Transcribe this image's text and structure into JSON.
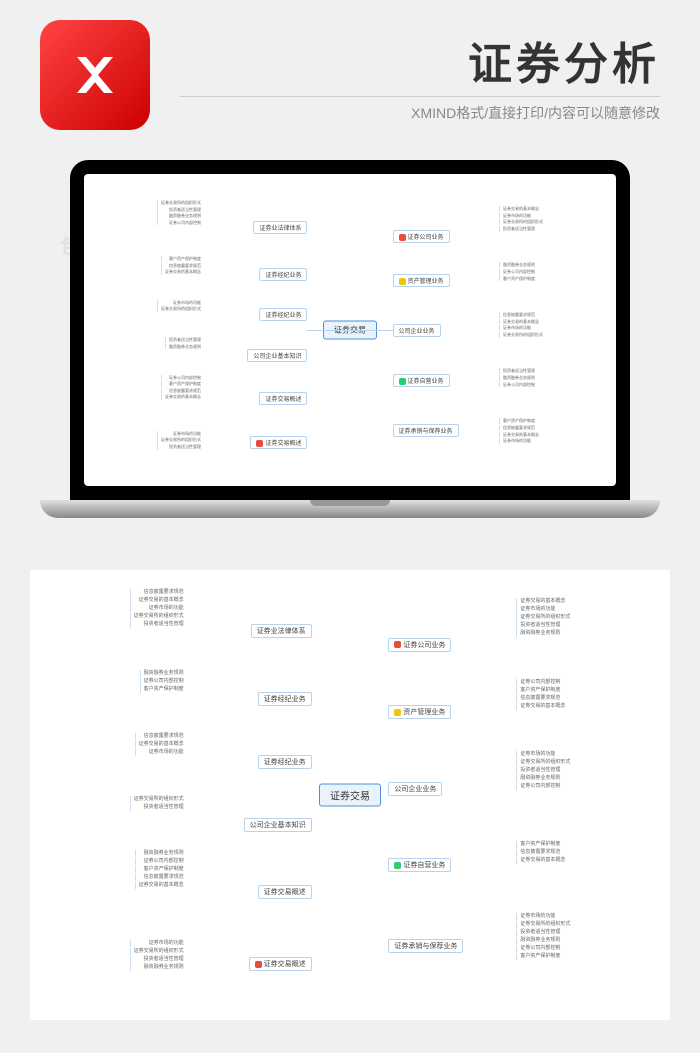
{
  "header": {
    "title": "证券分析",
    "subtitle": "XMIND格式/直接打印/内容可以随意修改"
  },
  "mindmap": {
    "center": "证券交易",
    "branches_right": [
      {
        "label": "证券公司业务",
        "marker": "#e74c3c"
      },
      {
        "label": "资产管理业务",
        "marker": "#f1c40f"
      },
      {
        "label": "公司企业业务",
        "marker": null
      },
      {
        "label": "证券自营业务",
        "marker": "#2ecc71"
      },
      {
        "label": "证券承销与保荐业务",
        "marker": null
      }
    ],
    "branches_left": [
      {
        "label": "证券业法律体系",
        "marker": null
      },
      {
        "label": "证券经纪业务",
        "marker": null
      },
      {
        "label": "证券经纪业务",
        "marker": null
      },
      {
        "label": "公司企业基本知识",
        "marker": null
      },
      {
        "label": "证券交易概述",
        "marker": null
      },
      {
        "label": "证券交易概述",
        "marker": "#e74c3c"
      }
    ],
    "leaves": [
      "证券交易的基本概念",
      "证券市场的功能",
      "证券交易所的组织形式",
      "投资者适当性管理",
      "融资融券业务规则",
      "证券公司内部控制",
      "客户资产保护制度",
      "信息披露要求规范"
    ]
  },
  "watermark_text": "包图网"
}
